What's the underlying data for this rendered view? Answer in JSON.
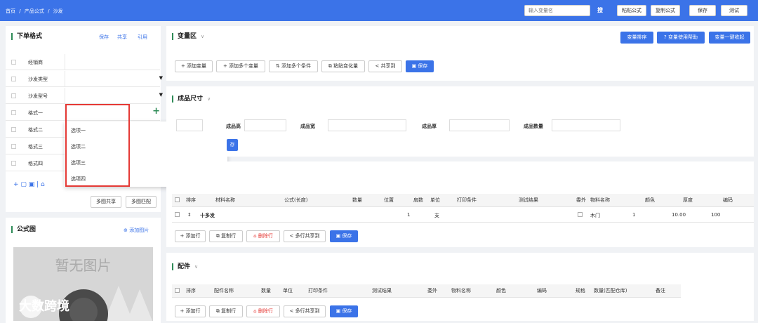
{
  "breadcrumb": {
    "home": "首页",
    "sep1": "/",
    "formula": "产品公式",
    "sep2": "/",
    "current": "沙发"
  },
  "topbar": {
    "search_placeholder": "输入变量名",
    "search_btn": "搜",
    "paste": "粘贴公式",
    "copy": "复制公式",
    "save": "保存",
    "test": "测试"
  },
  "order_format": {
    "title": "下单格式",
    "save": "保存",
    "share": "共享",
    "cite": "引用",
    "rows": [
      {
        "label": "经销商",
        "select": false
      },
      {
        "label": "沙发类型",
        "select": true
      },
      {
        "label": "沙发型号",
        "select": true
      },
      {
        "label": "格式一",
        "select": false
      },
      {
        "label": "格式二",
        "select": false
      },
      {
        "label": "格式三",
        "select": false
      },
      {
        "label": "格式四",
        "select": false
      }
    ],
    "dropdown_options": [
      "选项一",
      "选项二",
      "选项三",
      "选项四"
    ],
    "plus": "+",
    "tools": "+ ▢ ▣ | ⌂",
    "multi_share": "多图共享",
    "multi_match": "多图匹配"
  },
  "formula_pic": {
    "title": "公式图",
    "add": "添加图片",
    "placeholder": "暂无图片",
    "watermark": "大数跨境"
  },
  "var_area": {
    "title": "变量区",
    "sort": "变量排序",
    "help": "? 变量使用帮助",
    "collapse": "变量一键收起",
    "buttons": {
      "add_var": "+ 添加变量",
      "add_multi_var": "+ 添加多个变量",
      "add_multi_cond": "添加多个条件",
      "paste_var": "粘贴变化量",
      "share_to": "共享到",
      "save": "保存"
    }
  },
  "size_area": {
    "title": "成品尺寸",
    "fields": {
      "height": "成品高",
      "width": "成品宽",
      "thick": "成品厚",
      "qty": "成品数量"
    },
    "save": "存"
  },
  "materials": {
    "headers": {
      "sort": "排序",
      "name": "材料名称",
      "formula": "公式(长度)",
      "qty": "数量",
      "pos": "位置",
      "pieces": "扇数",
      "unit": "单位",
      "print": "打印条件",
      "result": "测试结果",
      "outsource": "委外",
      "item_name": "物料名称",
      "color": "颜色",
      "thickness": "厚度",
      "code": "编码"
    },
    "row": {
      "sort": "⇕",
      "name": "十多发",
      "pieces": "1",
      "unit": "支",
      "item_name": "木门",
      "color": "1",
      "thickness": "10.00",
      "code": "100"
    },
    "buttons": {
      "add": "+ 添加行",
      "copy": "复制行",
      "delete": "删除行",
      "multi_share": "多行共享到",
      "save": "保存"
    }
  },
  "parts": {
    "title": "配件",
    "headers": {
      "sort": "排序",
      "name": "配件名称",
      "qty": "数量",
      "unit": "单位",
      "print": "打印条件",
      "result": "测试结果",
      "outsource": "委外",
      "item_name": "物料名称",
      "color": "颜色",
      "code": "编码",
      "spec": "规格",
      "qty_match": "数量(匹配仓库)",
      "remark": "备注"
    },
    "buttons": {
      "add": "+ 添加行",
      "copy": "复制行",
      "delete": "删除行",
      "multi_share": "多行共享到",
      "save": "保存"
    }
  },
  "colors": {
    "accent": "#3b73e8",
    "green": "#2e8b57",
    "red": "#e53935"
  }
}
